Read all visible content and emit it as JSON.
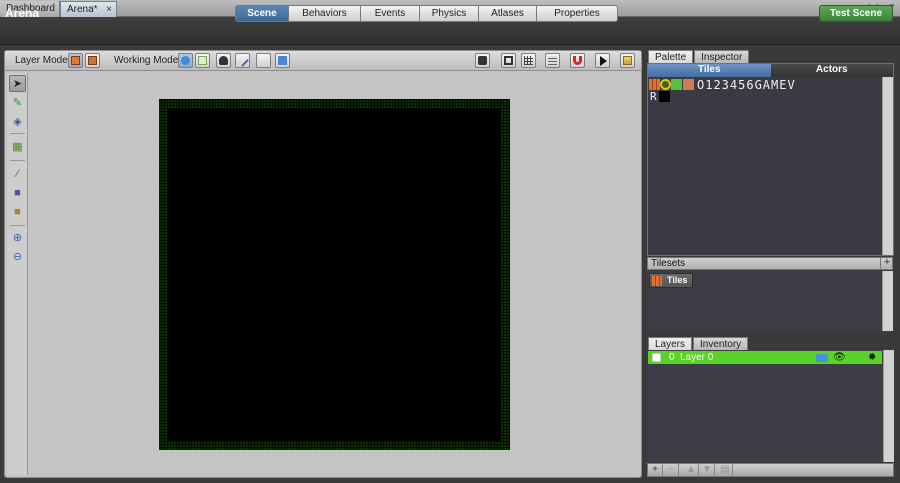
{
  "tabs": [
    {
      "label": "Dashboard"
    },
    {
      "label": "Arena*",
      "close": "×"
    }
  ],
  "header": {
    "scene_title": "Arena",
    "modes": [
      "Scene",
      "Behaviors",
      "Events",
      "Physics",
      "Atlases",
      "Properties"
    ],
    "active_mode": "Scene",
    "test_button": "Test Scene"
  },
  "toolbar": {
    "layer_mode_label": "Layer Mode",
    "working_mode_label": "Working Mode"
  },
  "palette": {
    "tabs": [
      "Palette",
      "Inspector"
    ],
    "subtabs": [
      "Tiles",
      "Actors"
    ],
    "glyphs": "O123456GAMEV",
    "glyph_second_row": "R"
  },
  "tilesets": {
    "title": "Tilesets",
    "add": "+",
    "item": "Tiles"
  },
  "layers": {
    "tabs": [
      "Layers",
      "Inventory"
    ],
    "row": {
      "index": "0",
      "name": "Layer 0"
    },
    "footer": [
      "+",
      "−",
      "▲",
      "▼",
      "▤"
    ]
  },
  "colors": {
    "accent": "#4a79a9",
    "test_button": "#4a934a",
    "layer_row": "#58d326",
    "scene_bg": "#000000",
    "border_tile": "#6fd02a"
  }
}
